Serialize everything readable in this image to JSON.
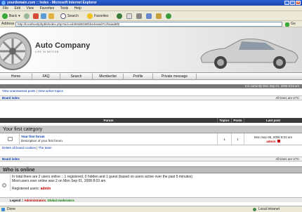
{
  "window": {
    "title": "yourdomain.com :: Index - Microsoft Internet Explorer",
    "controls": [
      "_",
      "□",
      "×"
    ]
  },
  "menu": [
    "File",
    "Edit",
    "View",
    "Favorites",
    "Tools",
    "Help"
  ],
  "toolbar": {
    "back": "Back",
    "search": "Search",
    "favorites": "Favorites"
  },
  "address": {
    "label": "Address",
    "url": "http://localhost/phpbb/index.php?sid=ed4b0d8339fcbe4ea6d7c2f4aad8f2",
    "go": "Go"
  },
  "header": {
    "site_title": "Auto Company",
    "site_subtitle": "LIFE IN MOTION"
  },
  "nav": [
    "Home",
    "FAQ",
    "Search",
    "Memberlist",
    "Profile",
    "Private message"
  ],
  "datebar": "It is currently Mon Sep 01, 2008 8:03 am",
  "view_links": {
    "unanswered": "View unanswered posts",
    "separator": "|",
    "active": "View active topics"
  },
  "board_index": {
    "label": "Board index",
    "timezone": "All times are UTC"
  },
  "table": {
    "headers": {
      "forum": "Forum",
      "topics": "Topics",
      "posts": "Posts",
      "last_post": "Last post"
    },
    "category": "Your first category",
    "forum": {
      "name": "Your first forum",
      "description": "Description of your first forum.",
      "topics": "1",
      "posts": "1",
      "last_post_date": "Mon Sep 08, 2008 8:03 am",
      "last_post_author": "admin"
    }
  },
  "bottom_links": {
    "delete_cookies": "Delete all board cookies",
    "separator": "|",
    "team": "The team"
  },
  "board_index_bottom": {
    "label": "Board index",
    "timezone": "All times are UTC"
  },
  "online": {
    "title": "Who is online",
    "line1": "In total there are 2 users online :: 1 registered, 0 hidden and 1 guest (based on users active over the past 5 minutes)",
    "line2": "Most users ever online was 2 on Mon Sep 01, 2008 8:03 am",
    "registered_label": "Registered users:",
    "registered_user": "admin",
    "legend_label": "Legend ::",
    "legend_admins": "Administrators",
    "legend_sep": ",",
    "legend_mods": "Global moderators"
  },
  "status": {
    "left": "Done",
    "zone": "Local intranet"
  },
  "colors": {
    "titlebar": "#1b46b0",
    "admin": "#c00000",
    "moderator": "#008000",
    "header_dark": "#3a3a3a"
  }
}
